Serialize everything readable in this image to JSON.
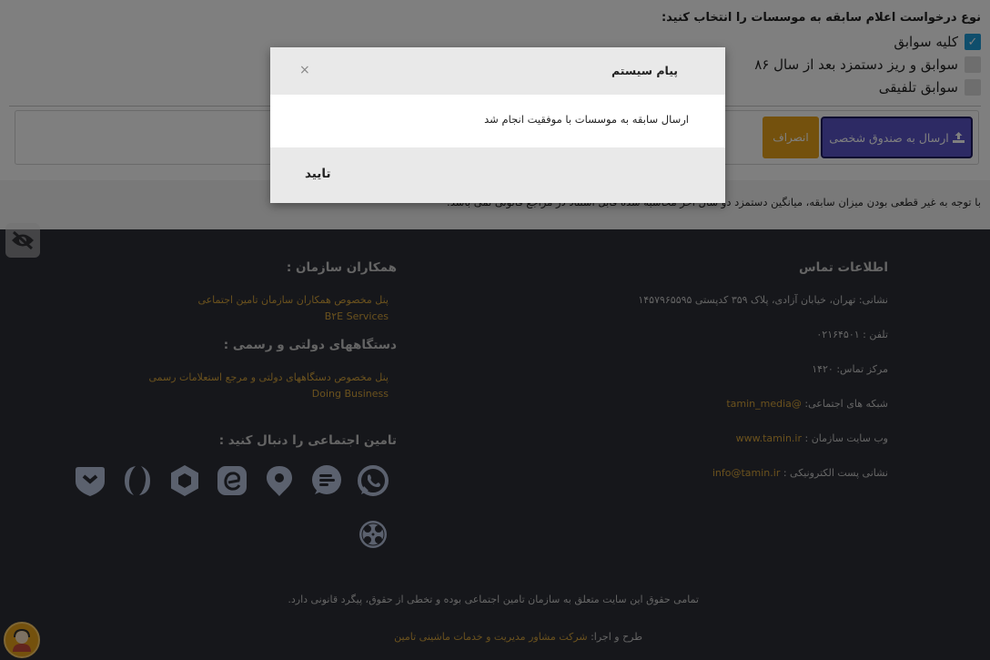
{
  "form": {
    "title": "نوع درخواست اعلام سابقه به موسسات را انتخاب کنید:",
    "options": [
      {
        "label": "کلیه سوابق",
        "checked": true
      },
      {
        "label": "سوابق و ریز دستمزد بعد از سال ۸۶",
        "checked": false
      },
      {
        "label": "سوابق تلفیقی",
        "checked": false
      }
    ],
    "send_button": "ارسال به صندوق شخصی",
    "cancel_button": "انصراف"
  },
  "notice": "با توجه به غیر قطعی بودن میزان سابقه، میانگین دستمزد دو سال آخر محاسبه شده قابل استناد در مراجع قانونی نمی باشد.",
  "footer": {
    "contact": {
      "heading": "اطلاعات تماس",
      "address": "نشانی: تهران، خیابان آزادی، پلاک ۳۵۹ کدپستی ۱۴۵۷۹۶۵۵۹۵",
      "phone": "تلفن : ۰۲۱۶۴۵۰۱",
      "call_center": "مرکز تماس: ۱۴۲۰",
      "social_label": "شبکه های اجتماعی:",
      "social_value": "@tamin_media",
      "website_label": "وب سایت سازمان :",
      "website_value": "www.tamin.ir",
      "email_label": "نشانی پست الکترونیکی :",
      "email_value": "info@tamin.ir"
    },
    "partners": {
      "heading": "همکاران سازمان :",
      "link1": "پنل مخصوص همکاران سازمان تامین اجتماعی",
      "link1_sub": "B۲E Services"
    },
    "government": {
      "heading": "دستگاههای دولتی و رسمی :",
      "link1": "پنل مخصوص دستگاههای دولتی و مرجع استعلامات رسمی",
      "link1_sub": "Doing Business"
    },
    "follow": {
      "heading": "تامین اجتماعی را دنبال کنید :"
    },
    "copyright": "تمامی حقوق این سایت متعلق به سازمان تامین اجتماعی بوده و تخطی از حقوق، پیگرد قانونی دارد.",
    "designer_label": "طرح و اجرا:",
    "designer_value": "شرکت مشاور مدیریت و خدمات ماشینی تامین"
  },
  "modal": {
    "title": "پیام سیستم",
    "message": "ارسال سابقه به موسسات با موفقیت انجام شد",
    "ok_button": "تایید",
    "close_symbol": "×"
  },
  "icons": {
    "checkbox_check": "✓"
  }
}
